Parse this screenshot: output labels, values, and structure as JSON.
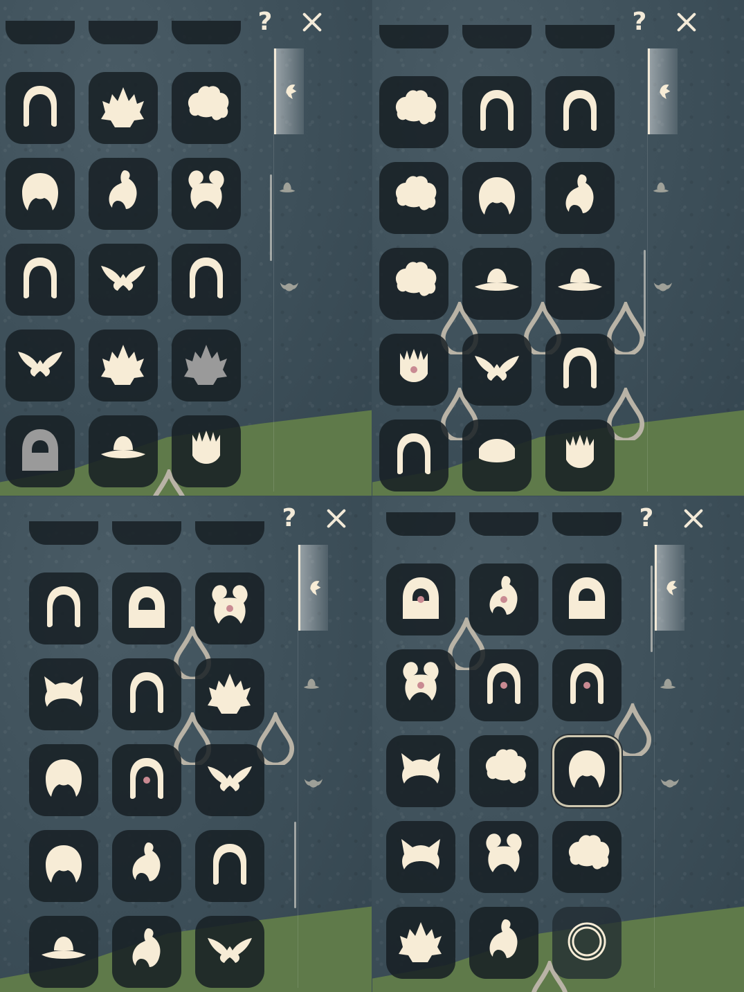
{
  "ui": {
    "help_label": "?",
    "close_label": "✕"
  },
  "categories": [
    "hair-icon",
    "hat-icon",
    "horns-icon"
  ],
  "panels": [
    {
      "id": "top-left",
      "active_category": "hair-icon",
      "scroll_position": 0.35,
      "tiles": [
        {
          "icon": "long-hair-icon"
        },
        {
          "icon": "spiky-hair-icon"
        },
        {
          "icon": "curly-bob-icon"
        },
        {
          "icon": "short-bob-icon"
        },
        {
          "icon": "bun-hair-icon"
        },
        {
          "icon": "double-bun-icon"
        },
        {
          "icon": "pigtail-hair-icon"
        },
        {
          "icon": "wing-hair-icon"
        },
        {
          "icon": "braided-long-icon"
        },
        {
          "icon": "swept-hair-icon"
        },
        {
          "icon": "peak-hair-icon"
        },
        {
          "icon": "spiky-grey-icon"
        },
        {
          "icon": "hood-grey-icon"
        },
        {
          "icon": "cone-hat-icon",
          "drop": true
        },
        {
          "icon": "crowned-curls-icon"
        }
      ]
    },
    {
      "id": "top-right",
      "active_category": "hair-icon",
      "scroll_position": 0.6,
      "tiles": [
        {
          "icon": "twin-curls-icon"
        },
        {
          "icon": "long-straight-icon"
        },
        {
          "icon": "mid-length-icon"
        },
        {
          "icon": "fluffy-hair-icon"
        },
        {
          "icon": "round-bob-icon"
        },
        {
          "icon": "ponytail-icon"
        },
        {
          "icon": "big-fluff-icon",
          "drop": true
        },
        {
          "icon": "straw-hat-icon",
          "drop": true
        },
        {
          "icon": "flat-hat-icon",
          "drop": true
        },
        {
          "icon": "flower-crown-icon",
          "drop": true
        },
        {
          "icon": "swept-bob-icon"
        },
        {
          "icon": "braids-icon",
          "drop": true
        },
        {
          "icon": "wavy-long-icon"
        },
        {
          "icon": "cap-hat-icon"
        },
        {
          "icon": "tall-crown-icon"
        }
      ]
    },
    {
      "id": "bottom-left",
      "active_category": "hair-icon",
      "scroll_position": 0.85,
      "tiles": [
        {
          "icon": "side-braid-icon"
        },
        {
          "icon": "cat-hood-icon",
          "drop": true
        },
        {
          "icon": "ribbon-long-icon"
        },
        {
          "icon": "fox-ears-icon"
        },
        {
          "icon": "round-ornament-icon",
          "drop": true
        },
        {
          "icon": "flame-hair-icon",
          "drop": true
        },
        {
          "icon": "short-side-icon"
        },
        {
          "icon": "dreadlocks-icon"
        },
        {
          "icon": "feathered-icon"
        },
        {
          "icon": "layered-bob-icon"
        },
        {
          "icon": "updo-icon"
        },
        {
          "icon": "headband-icon"
        },
        {
          "icon": "tassel-hat-icon"
        },
        {
          "icon": "bun-wavy-icon"
        },
        {
          "icon": "flowing-long-icon"
        }
      ]
    },
    {
      "id": "bottom-right",
      "active_category": "hair-icon",
      "scroll_position": 0.0,
      "selected_index": 8,
      "tiles": [
        {
          "icon": "pink-hood-icon",
          "drop": true
        },
        {
          "icon": "bow-updo-icon"
        },
        {
          "icon": "lion-mask-icon"
        },
        {
          "icon": "twin-ribbons-icon"
        },
        {
          "icon": "bandana-long-icon"
        },
        {
          "icon": "tall-wrap-icon",
          "drop": true
        },
        {
          "icon": "cat-ear-hair-icon"
        },
        {
          "icon": "curly-long-icon"
        },
        {
          "icon": "messy-short-icon"
        },
        {
          "icon": "bunny-ears-icon"
        },
        {
          "icon": "twin-tails-icon"
        },
        {
          "icon": "swirl-hair-icon"
        },
        {
          "icon": "flame-short-icon"
        },
        {
          "icon": "side-pony-icon",
          "drop": true
        },
        {
          "icon": "empty-slot-icon",
          "empty": true
        }
      ]
    }
  ],
  "colors": {
    "icon": "#f7ecd6",
    "icon_accent": "#c98a92",
    "tile_bg": "#171f24",
    "grass": "#5f7a4a"
  }
}
